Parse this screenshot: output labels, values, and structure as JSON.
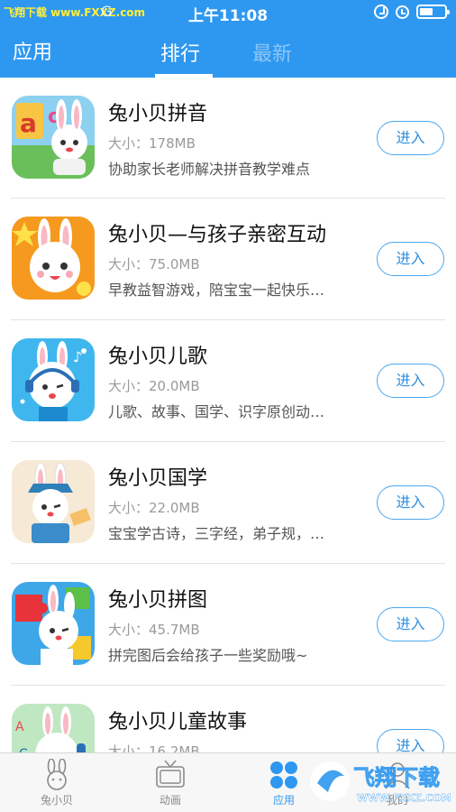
{
  "status_bar": {
    "watermark": "飞翔下载 www.FXXZ.com",
    "carrier": "G",
    "time": "上午11:08",
    "battery_level": 0.55
  },
  "header": {
    "title": "应用",
    "tabs": [
      {
        "label": "排行",
        "active": true
      },
      {
        "label": "最新",
        "active": false
      }
    ]
  },
  "apps": [
    {
      "name": "兔小贝拼音",
      "size": "大小：178MB",
      "desc": "协助家长老师解决拼音教学难点",
      "button": "进入"
    },
    {
      "name": "兔小贝—与孩子亲密互动",
      "size": "大小：75.0MB",
      "desc": "早教益智游戏，陪宝宝一起快乐…",
      "button": "进入"
    },
    {
      "name": "兔小贝儿歌",
      "size": "大小：20.0MB",
      "desc": "儿歌、故事、国学、识字原创动…",
      "button": "进入"
    },
    {
      "name": "兔小贝国学",
      "size": "大小：22.0MB",
      "desc": "宝宝学古诗，三字经，弟子规，…",
      "button": "进入"
    },
    {
      "name": "兔小贝拼图",
      "size": "大小：45.7MB",
      "desc": "拼完图后会给孩子一些奖励哦~",
      "button": "进入"
    },
    {
      "name": "兔小贝儿童故事",
      "size": "大小：16.2MB",
      "desc": "",
      "button": "进入"
    }
  ],
  "tabbar": {
    "items": [
      {
        "label": "兔小贝",
        "icon": "rabbit-icon",
        "active": false
      },
      {
        "label": "动画",
        "icon": "tv-icon",
        "active": false
      },
      {
        "label": "应用",
        "icon": "apps-grid-icon",
        "active": true
      },
      {
        "label": "我的",
        "icon": "profile-icon",
        "active": false
      }
    ]
  },
  "watermark_br": {
    "text": "飞翔下载",
    "url": "WWW.FXXZ.COM"
  },
  "colors": {
    "primary": "#2e98f0",
    "button_border": "#4aa7f0",
    "divider": "#e2e2e2"
  }
}
